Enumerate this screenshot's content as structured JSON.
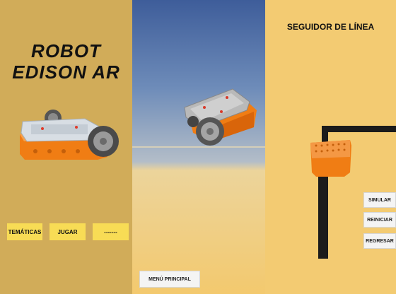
{
  "left_panel": {
    "title_line1": "ROBOT",
    "title_line2": "EDISON AR",
    "buttons": [
      "TEMÁTICAS",
      "JUGAR",
      "-------"
    ]
  },
  "middle_panel": {
    "main_menu_label": "MENÚ PRINCIPAL"
  },
  "right_panel": {
    "heading": "SEGUIDOR DE LÍNEA",
    "buttons": [
      "SIMULAR",
      "REINICIAR",
      "REGRESAR"
    ]
  },
  "colors": {
    "left_bg": "#d1ac59",
    "right_bg": "#f3cb72",
    "yellow_button": "#f8dc55",
    "robot_orange": "#f07d14",
    "track": "#1b1b1b"
  }
}
